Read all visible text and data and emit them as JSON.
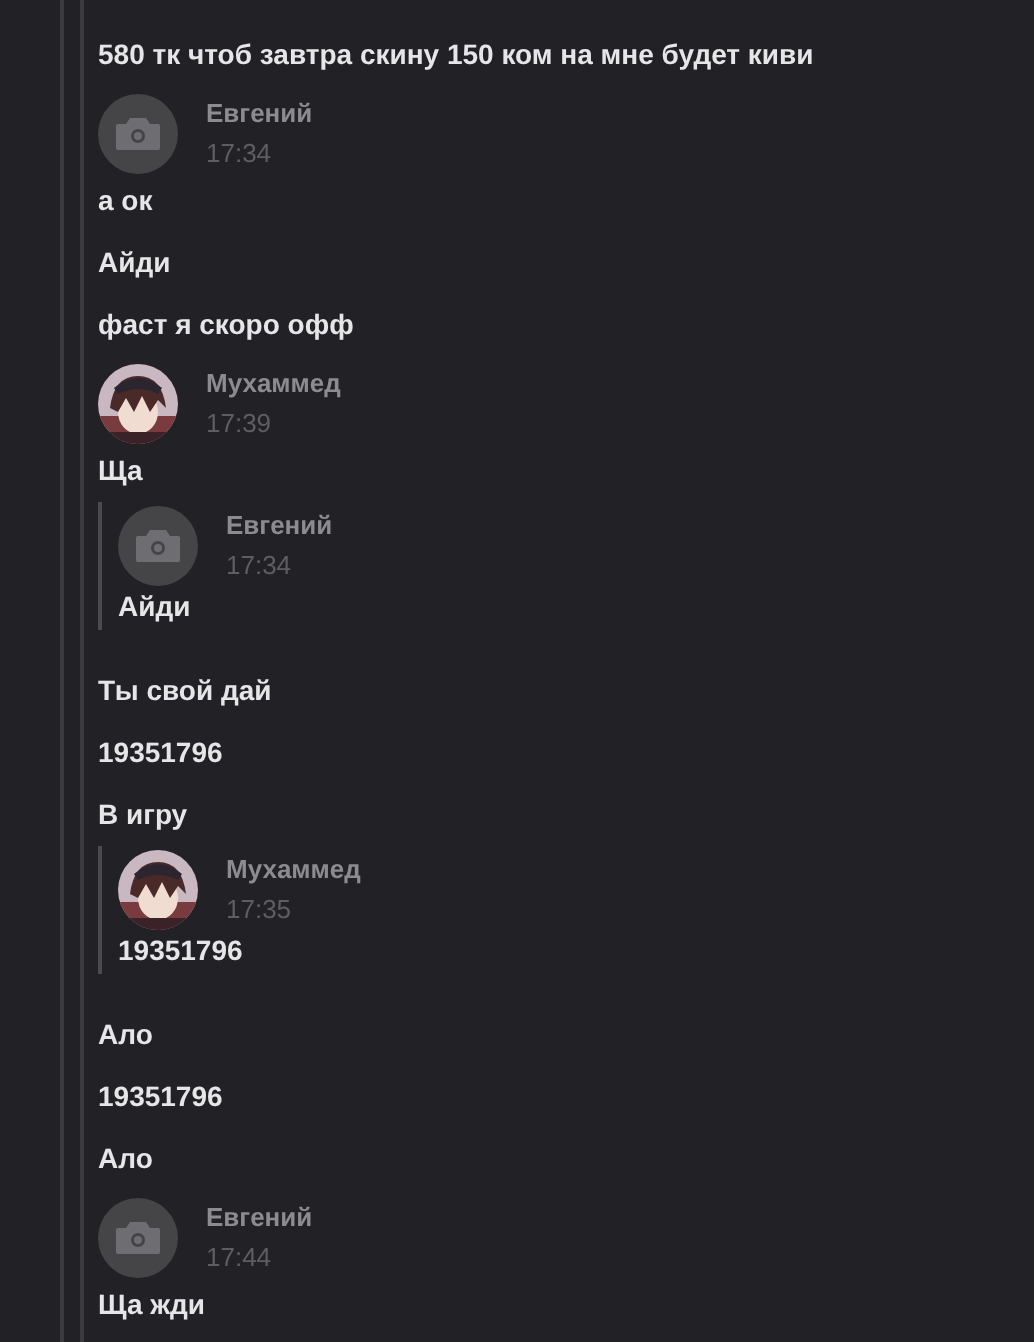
{
  "messages": [
    {
      "kind": "text",
      "text": "580 тк чтоб завтра скину 150 ком на мне будет киви"
    },
    {
      "kind": "header",
      "avatar": {
        "kind": "camera"
      },
      "author": "Евгений",
      "time": "17:34"
    },
    {
      "kind": "text",
      "text": "а ок"
    },
    {
      "kind": "text",
      "text": "Айди"
    },
    {
      "kind": "text",
      "text": "фаст я скоро офф"
    },
    {
      "kind": "header",
      "author": "Мухаммед",
      "time": "17:39"
    },
    {
      "kind": "text",
      "text": "Ща"
    },
    {
      "kind": "quote",
      "avatar": {
        "kind": "camera"
      },
      "author": "Евгений",
      "time": "17:34",
      "text": "Айди"
    },
    {
      "kind": "text",
      "text": "Ты свой дай"
    },
    {
      "kind": "text",
      "text": "19351796"
    },
    {
      "kind": "text",
      "text": "В игру"
    },
    {
      "kind": "quote",
      "author": "Мухаммед",
      "time": "17:35",
      "text": "19351796"
    },
    {
      "kind": "text",
      "text": "Ало"
    },
    {
      "kind": "text",
      "text": "19351796"
    },
    {
      "kind": "text",
      "text": "Ало"
    },
    {
      "kind": "header",
      "avatar": {
        "kind": "camera"
      },
      "author": "Евгений",
      "time": "17:44"
    },
    {
      "kind": "text",
      "text": "Ща жди"
    }
  ]
}
